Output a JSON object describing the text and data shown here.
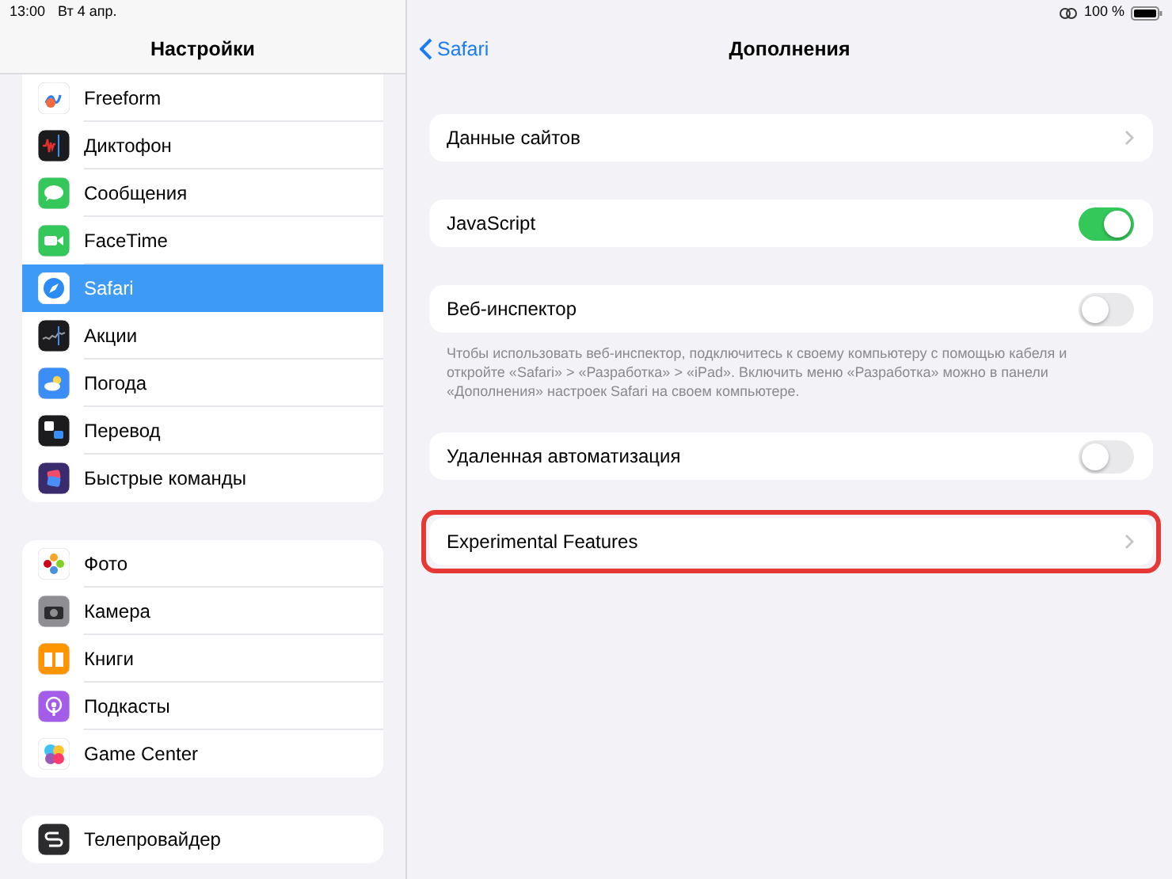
{
  "status_bar": {
    "time": "13:00",
    "date": "Вт 4 апр.",
    "battery": "100 %"
  },
  "sidebar": {
    "title": "Настройки",
    "groups": [
      [
        {
          "label": "Freeform",
          "selected": false
        },
        {
          "label": "Диктофон",
          "selected": false
        },
        {
          "label": "Сообщения",
          "selected": false
        },
        {
          "label": "FaceTime",
          "selected": false
        },
        {
          "label": "Safari",
          "selected": true
        },
        {
          "label": "Акции",
          "selected": false
        },
        {
          "label": "Погода",
          "selected": false
        },
        {
          "label": "Перевод",
          "selected": false
        },
        {
          "label": "Быстрые команды",
          "selected": false
        }
      ],
      [
        {
          "label": "Фото",
          "selected": false
        },
        {
          "label": "Камера",
          "selected": false
        },
        {
          "label": "Книги",
          "selected": false
        },
        {
          "label": "Подкасты",
          "selected": false
        },
        {
          "label": "Game Center",
          "selected": false
        }
      ],
      [
        {
          "label": "Телепровайдер",
          "selected": false
        }
      ]
    ]
  },
  "detail": {
    "back": "Safari",
    "title": "Дополнения",
    "rows": [
      {
        "kind": "link",
        "label": "Данные сайтов",
        "highlighted": false
      },
      {
        "kind": "toggle",
        "label": "JavaScript",
        "on": true,
        "highlighted": false
      },
      {
        "kind": "toggle",
        "label": "Веб-инспектор",
        "on": false,
        "highlighted": false,
        "note": "Чтобы использовать веб-инспектор, подключитесь к своему компьютеру с помощью кабеля и откройте «Safari» > «Разработка» > «iPad». Включить меню «Разработка» можно в панели «Дополнения» настроек Safari на своем компьютере."
      },
      {
        "kind": "toggle",
        "label": "Удаленная автоматизация",
        "on": false,
        "highlighted": false
      },
      {
        "kind": "link",
        "label": "Experimental Features",
        "highlighted": true
      }
    ]
  }
}
